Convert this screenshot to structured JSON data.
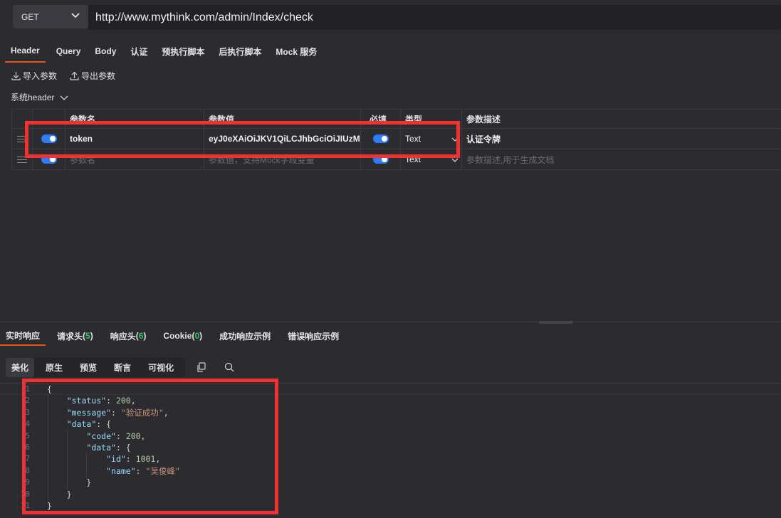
{
  "request": {
    "method": "GET",
    "url": "http://www.mythink.com/admin/Index/check",
    "tabs": [
      "Header",
      "Query",
      "Body",
      "认证",
      "预执行脚本",
      "后执行脚本",
      "Mock 服务"
    ],
    "active_tab": "Header"
  },
  "actions": {
    "import_label": "导入参数",
    "export_label": "导出参数"
  },
  "sysheader_label": "系统header",
  "params_table": {
    "headers": {
      "name": "参数名",
      "value": "参数值",
      "required": "必填",
      "type": "类型",
      "desc": "参数描述"
    },
    "rows": [
      {
        "enabled": true,
        "name": "token",
        "value": "eyJ0eXAiOiJKV1QiLCJhbGciOiJIUzM",
        "required": true,
        "type": "Text",
        "desc": "认证令牌"
      }
    ],
    "new_row": {
      "name_placeholder": "参数名",
      "value_placeholder": "参数值，支持Mock字段变量",
      "type": "Text",
      "desc_placeholder": "参数描述,用于生成文档"
    }
  },
  "response": {
    "tabs": [
      {
        "label": "实时响应"
      },
      {
        "label": "请求头",
        "count": "5"
      },
      {
        "label": "响应头",
        "count": "6"
      },
      {
        "label": "Cookie",
        "count": "0"
      },
      {
        "label": "成功响应示例"
      },
      {
        "label": "错误响应示例"
      }
    ],
    "view_tabs": [
      "美化",
      "原生",
      "预览",
      "断言",
      "可视化"
    ],
    "active_view": "美化",
    "line_numbers": [
      "1",
      "2",
      "3",
      "4",
      "5",
      "6",
      "7",
      "8",
      "9",
      "10",
      "11"
    ],
    "body": {
      "status": 200,
      "message": "验证成功",
      "data": {
        "code": 200,
        "data": {
          "id": 1001,
          "name": "吴俊峰"
        }
      }
    }
  },
  "colors": {
    "accent": "#e8541e",
    "toggle": "#2f7cf6",
    "highlight_box": "#f03232",
    "count": "#2ec76a"
  }
}
